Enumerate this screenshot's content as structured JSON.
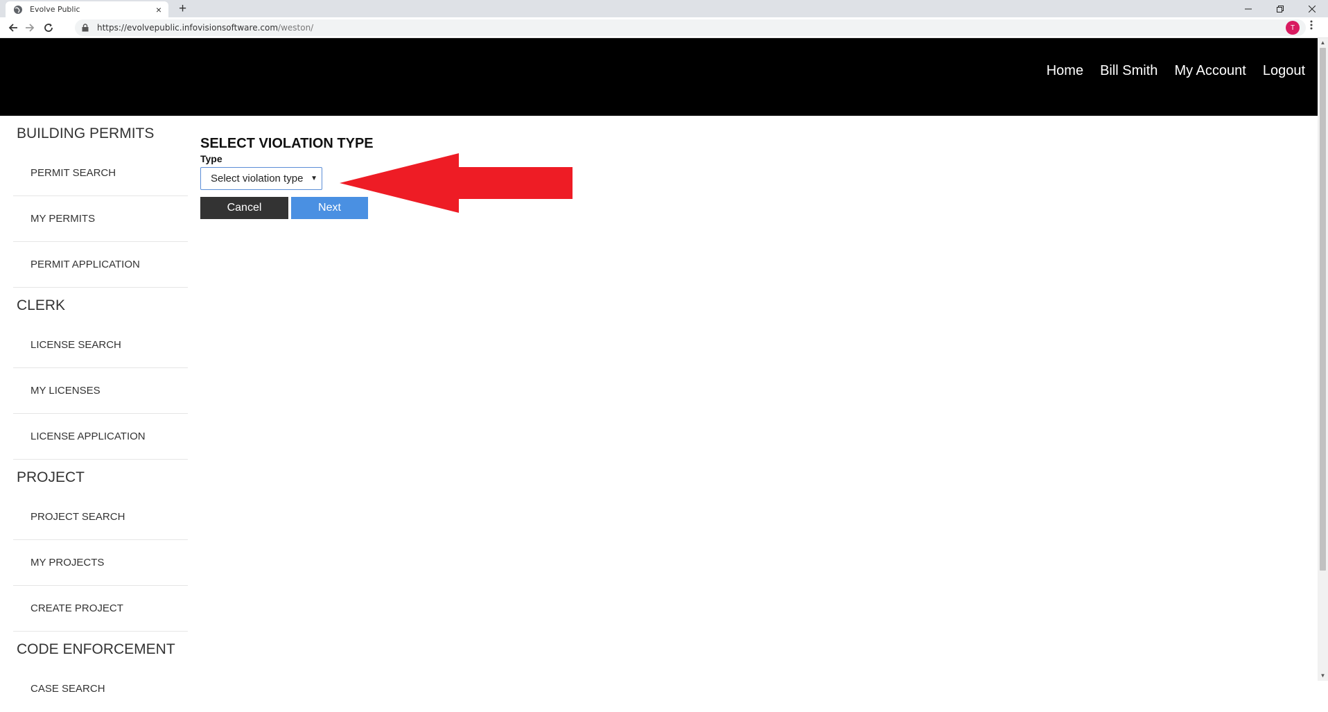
{
  "browser": {
    "tab_title": "Evolve Public",
    "tab_close": "×",
    "new_tab": "+",
    "url_host": "https://evolvepublic.infovisionsoftware.com",
    "url_path": "/weston/",
    "profile_initial": "T"
  },
  "header": {
    "nav": [
      "Home",
      "Bill Smith",
      "My Account",
      "Logout"
    ]
  },
  "sidebar": {
    "sections": [
      {
        "title": "BUILDING PERMITS",
        "items": [
          "PERMIT SEARCH",
          "MY PERMITS",
          "PERMIT APPLICATION"
        ]
      },
      {
        "title": "CLERK",
        "items": [
          "LICENSE SEARCH",
          "MY LICENSES",
          "LICENSE APPLICATION"
        ]
      },
      {
        "title": "PROJECT",
        "items": [
          "PROJECT SEARCH",
          "MY PROJECTS",
          "CREATE PROJECT"
        ]
      },
      {
        "title": "CODE ENFORCEMENT",
        "items": [
          "CASE SEARCH"
        ]
      }
    ]
  },
  "main": {
    "title": "SELECT VIOLATION TYPE",
    "type_label": "Type",
    "type_select_value": "Select violation type",
    "cancel_label": "Cancel",
    "next_label": "Next"
  },
  "colors": {
    "header_bg": "#000000",
    "cancel_bg": "#333333",
    "next_bg": "#4a90e2",
    "annotation": "#ee1c25"
  },
  "icons": {
    "favicon": "globe-icon",
    "back": "back-arrow-icon",
    "forward": "forward-arrow-icon",
    "reload": "reload-icon",
    "lock": "lock-icon",
    "bookmark": "star-icon",
    "menu": "kebab-menu-icon",
    "dropdown": "dropdown-caret-icon"
  }
}
